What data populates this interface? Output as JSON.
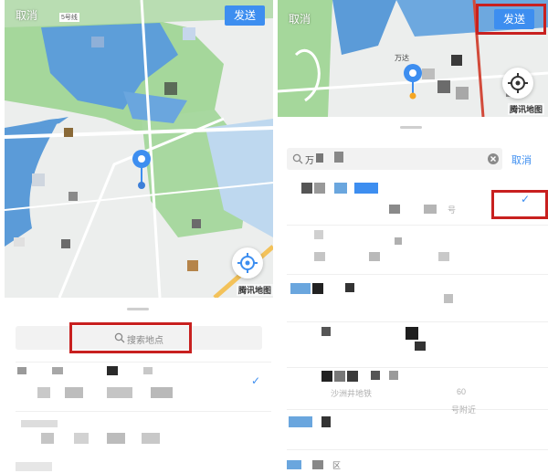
{
  "left_screen": {
    "header": {
      "cancel_label": "取消",
      "send_label": "发送"
    },
    "map": {
      "brand_label": "腾讯地图",
      "top_label": "5号线"
    },
    "search": {
      "placeholder": "搜索地点"
    },
    "icons": {
      "pin": "location-pin-icon",
      "locate": "locate-icon",
      "search": "search-icon",
      "check": "check-icon"
    }
  },
  "right_screen": {
    "header": {
      "cancel_label": "取消",
      "send_label": "发送"
    },
    "map": {
      "brand_label": "腾讯地图",
      "place_label": "万达"
    },
    "search": {
      "cancel_label": "取消",
      "query_fragment": "万"
    },
    "list_fragments": {
      "row1_tail": "号",
      "row6_tail": "沙洲井地铁",
      "row6_num": "60",
      "row6_near": "号附近",
      "row8_tail": "区"
    }
  },
  "colors": {
    "accent": "#3d8ef0",
    "annotation_red": "#c8201f",
    "water": "#5b9bd8",
    "park": "#9fd39a"
  }
}
